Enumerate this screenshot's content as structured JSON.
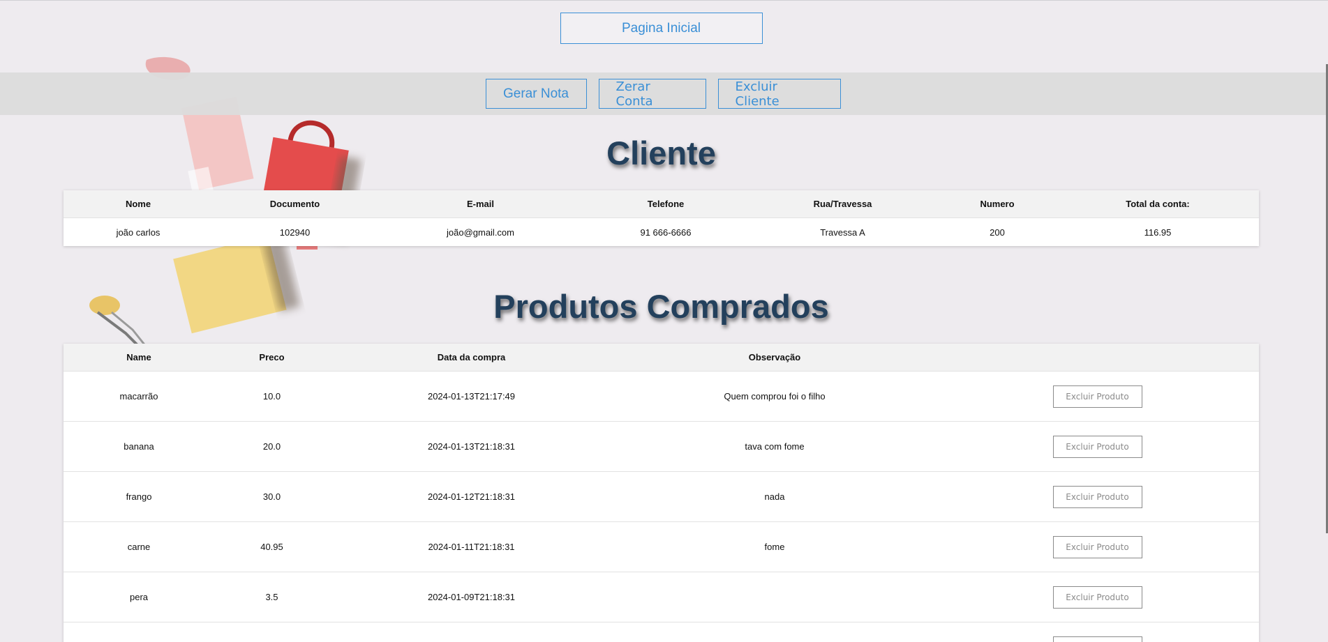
{
  "nav": {
    "home_label": "Pagina Inicial"
  },
  "actions": {
    "generate_invoice": "Gerar Nota",
    "reset_account": "Zerar Conta",
    "delete_client": "Excluir Cliente"
  },
  "client_section": {
    "title": "Cliente",
    "headers": [
      "Nome",
      "Documento",
      "E-mail",
      "Telefone",
      "Rua/Travessa",
      "Numero",
      "Total da conta:"
    ],
    "row": [
      "joão carlos",
      "102940",
      "joão@gmail.com",
      "91 666-6666",
      "Travessa A",
      "200",
      "116.95"
    ]
  },
  "products_section": {
    "title": "Produtos Comprados",
    "headers": [
      "Name",
      "Preco",
      "Data da compra",
      "Observação",
      ""
    ],
    "delete_label": "Excluir Produto",
    "rows": [
      [
        "macarrão",
        "10.0",
        "2024-01-13T21:17:49",
        "Quem comprou foi o filho"
      ],
      [
        "banana",
        "20.0",
        "2024-01-13T21:18:31",
        "tava com fome"
      ],
      [
        "frango",
        "30.0",
        "2024-01-12T21:18:31",
        "nada"
      ],
      [
        "carne",
        "40.95",
        "2024-01-11T21:18:31",
        "fome"
      ],
      [
        "pera",
        "3.5",
        "2024-01-09T21:18:31",
        ""
      ],
      [
        "",
        "",
        "",
        ""
      ]
    ]
  },
  "colors": {
    "accent": "#3a8fd6",
    "heading": "#23405c",
    "background": "#eeebef",
    "bar": "#dcdcdc"
  }
}
